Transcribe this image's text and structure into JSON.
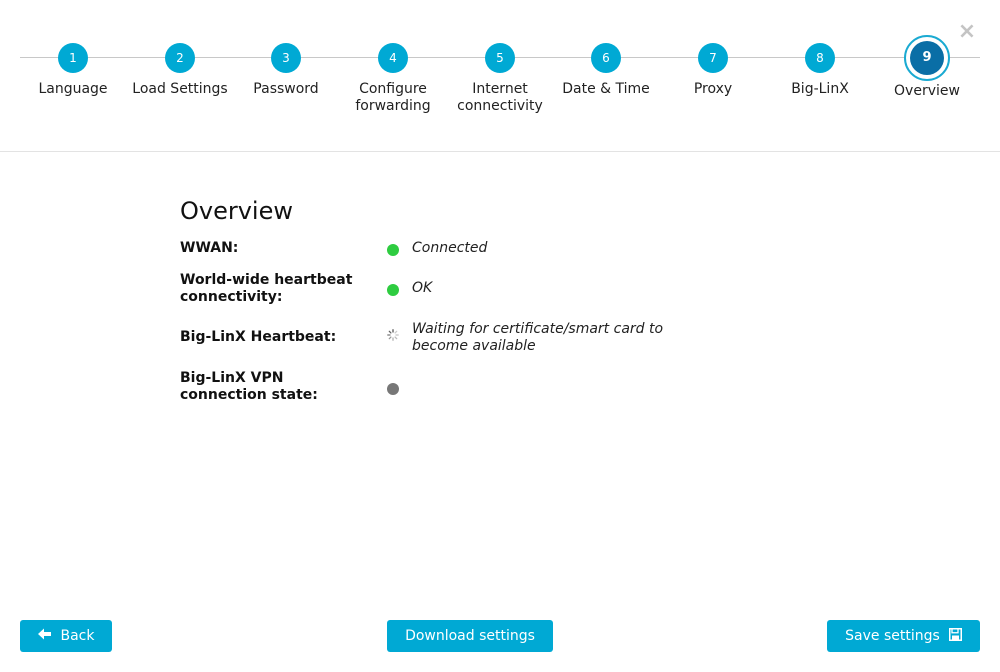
{
  "window": {
    "close_glyph": "×"
  },
  "steps": [
    {
      "number": "1",
      "label": "Language"
    },
    {
      "number": "2",
      "label": "Load Settings"
    },
    {
      "number": "3",
      "label": "Password"
    },
    {
      "number": "4",
      "label": "Configure forwarding"
    },
    {
      "number": "5",
      "label": "Internet connectivity"
    },
    {
      "number": "6",
      "label": "Date & Time"
    },
    {
      "number": "7",
      "label": "Proxy"
    },
    {
      "number": "8",
      "label": "Big-LinX"
    },
    {
      "number": "9",
      "label": "Overview"
    }
  ],
  "active_step": "9",
  "overview": {
    "title": "Overview",
    "rows": [
      {
        "label": "WWAN:",
        "status": "green",
        "value": "Connected"
      },
      {
        "label": "World-wide heartbeat connectivity:",
        "status": "green",
        "value": "OK"
      },
      {
        "label": "Big-LinX Heartbeat:",
        "status": "spinner",
        "value": "Waiting for certificate/smart card to become available"
      },
      {
        "label": "Big-LinX VPN connection state:",
        "status": "gray",
        "value": ""
      }
    ]
  },
  "footer": {
    "back_label": "Back",
    "download_label": "Download settings",
    "save_label": "Save settings"
  },
  "colors": {
    "accent": "#00a9d4",
    "active_step": "#0a6ea6",
    "status_ok": "#2ecc40",
    "status_unknown": "#777777"
  },
  "icons": {
    "back": "arrow-left-icon",
    "save": "floppy-disk-icon",
    "close": "close-icon",
    "heartbeat_status": "spinner-icon"
  }
}
